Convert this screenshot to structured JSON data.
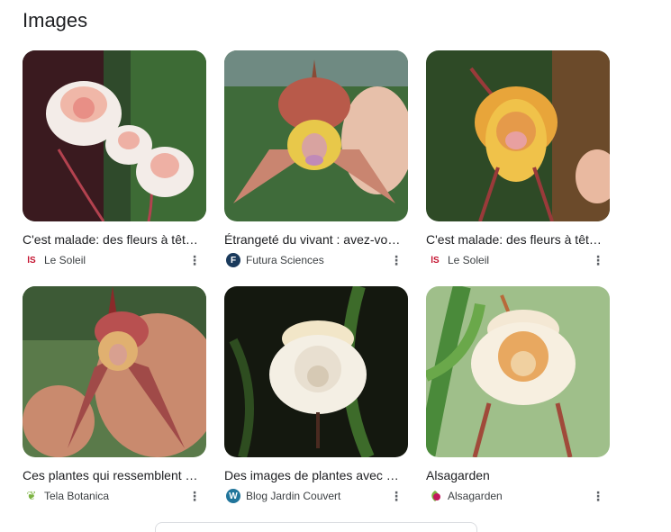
{
  "section": {
    "title": "Images"
  },
  "cards": [
    {
      "caption": "C'est malade: des fleurs à têt…",
      "source": "Le Soleil",
      "favicon": "ls-favicon",
      "favicon_color": "#c4122f"
    },
    {
      "caption": "Étrangeté du vivant : avez-vo…",
      "source": "Futura Sciences",
      "favicon": "futura-favicon",
      "favicon_color": "#1a3a5c"
    },
    {
      "caption": "C'est malade: des fleurs à têt…",
      "source": "Le Soleil",
      "favicon": "ls-favicon",
      "favicon_color": "#c4122f"
    },
    {
      "caption": "Ces plantes qui ressemblent …",
      "source": "Tela Botanica",
      "favicon": "leaf-favicon",
      "favicon_color": "#7cb342"
    },
    {
      "caption": "Des images de plantes avec …",
      "source": "Blog Jardin Couvert",
      "favicon": "wordpress-favicon",
      "favicon_color": "#21759b"
    },
    {
      "caption": "Alsagarden",
      "source": "Alsagarden",
      "favicon": "alsagarden-favicon",
      "favicon_color": "#c2185b"
    }
  ],
  "icons": {
    "more": "more-vert-icon"
  }
}
